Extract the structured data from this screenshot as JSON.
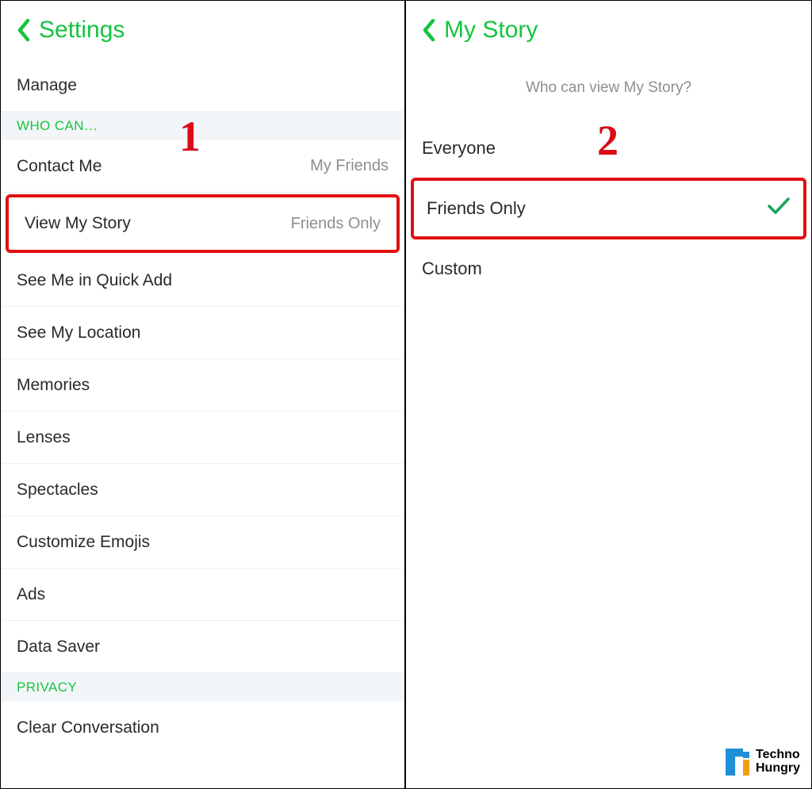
{
  "colors": {
    "accent": "#16c43e",
    "highlight": "#e10f12"
  },
  "left": {
    "step_number": "1",
    "title": "Settings",
    "manage_row": "Manage",
    "section_who_can": "WHO CAN…",
    "rows": {
      "contact_me": {
        "label": "Contact Me",
        "value": "My Friends"
      },
      "view_my_story": {
        "label": "View My Story",
        "value": "Friends Only"
      },
      "see_me_quick_add": {
        "label": "See Me in Quick Add"
      },
      "see_my_location": {
        "label": "See My Location"
      },
      "memories": {
        "label": "Memories"
      },
      "lenses": {
        "label": "Lenses"
      },
      "spectacles": {
        "label": "Spectacles"
      },
      "customize_emojis": {
        "label": "Customize Emojis"
      },
      "ads": {
        "label": "Ads"
      },
      "data_saver": {
        "label": "Data Saver"
      }
    },
    "section_privacy": "PRIVACY",
    "clear_conversation": "Clear Conversation"
  },
  "right": {
    "step_number": "2",
    "title": "My Story",
    "prompt": "Who can view My Story?",
    "options": {
      "everyone": {
        "label": "Everyone",
        "selected": false
      },
      "friends_only": {
        "label": "Friends Only",
        "selected": true
      },
      "custom": {
        "label": "Custom",
        "selected": false
      }
    }
  },
  "watermark": {
    "line1": "Techno",
    "line2": "Hungry"
  }
}
